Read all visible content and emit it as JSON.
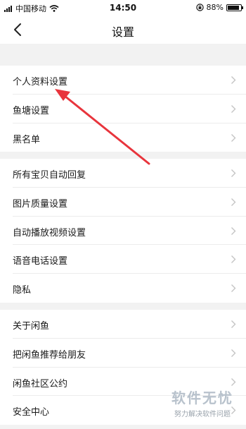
{
  "status_bar": {
    "carrier": "中国移动",
    "time": "14:50",
    "battery": "88%",
    "battery_level": 0.88
  },
  "nav": {
    "title": "设置",
    "back_icon": "chevron-left-icon"
  },
  "groups": [
    {
      "items": [
        {
          "label": "个人资料设置"
        },
        {
          "label": "鱼塘设置"
        },
        {
          "label": "黑名单"
        }
      ]
    },
    {
      "items": [
        {
          "label": "所有宝贝自动回复"
        },
        {
          "label": "图片质量设置"
        },
        {
          "label": "自动播放视频设置"
        },
        {
          "label": "语音电话设置"
        },
        {
          "label": "隐私"
        }
      ]
    },
    {
      "items": [
        {
          "label": "关于闲鱼"
        },
        {
          "label": "把闲鱼推荐给朋友"
        },
        {
          "label": "闲鱼社区公约"
        },
        {
          "label": "安全中心"
        }
      ]
    }
  ],
  "annotation": {
    "color": "#e8343c"
  },
  "watermark": {
    "main": "软件无忧",
    "sub": "努力解决软件问题"
  },
  "colors": {
    "background": "#f2f2f2",
    "row": "#ffffff",
    "chevron": "#c4c4c4"
  }
}
